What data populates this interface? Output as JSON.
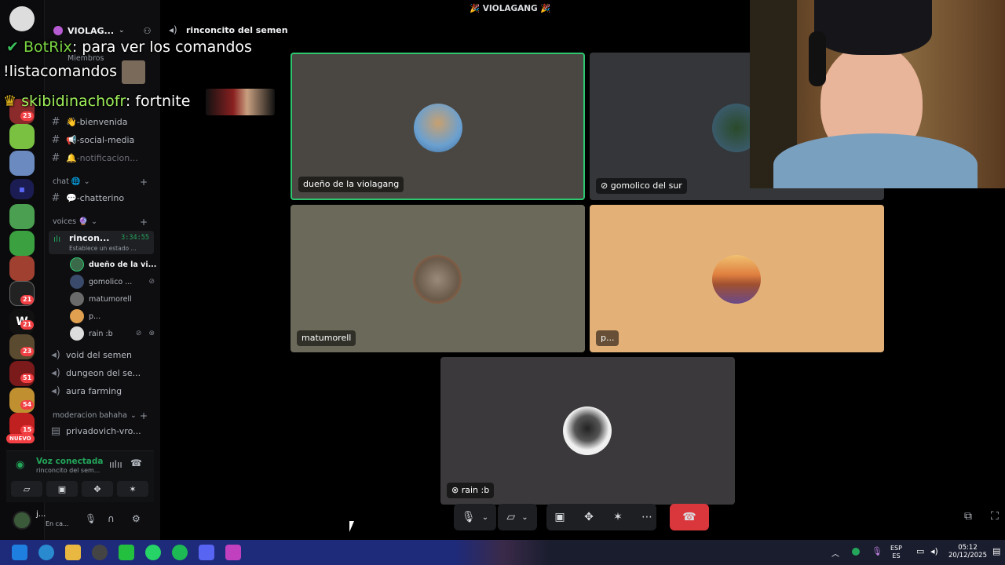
{
  "window": {
    "title": "🎉 VIOLAGANG 🎉"
  },
  "server": {
    "name": "VIOLAG...",
    "members_label": "Miembros"
  },
  "voice_channel_header": "rinconcito del semen",
  "chat_overlay": [
    {
      "user": "BotRix",
      "text": ": para ver los comandos"
    },
    {
      "user": "",
      "text": "!listacomandos"
    },
    {
      "user": "skibidinachofr",
      "text": ": fortnite"
    }
  ],
  "channels": {
    "text": [
      {
        "label": "👋-bienvenida"
      },
      {
        "label": "📢-social-media"
      },
      {
        "label": "🔔-notificacion..."
      }
    ],
    "chat_category": "chat 🌐",
    "chat": [
      {
        "label": "💬-chatterino"
      }
    ],
    "voices_category": "voices 🔮",
    "active_voice": {
      "name": "rincon...",
      "timer": "3:34:55",
      "status": "Establece un estado ..."
    },
    "voice_users": [
      {
        "name": "dueño de la vi...",
        "color": "#3a6a4a",
        "icon": ""
      },
      {
        "name": "gomolico ...",
        "color": "#3a4a6a",
        "icon": "mic-off"
      },
      {
        "name": "matumorell",
        "color": "#6a6a6a",
        "icon": ""
      },
      {
        "name": "p...",
        "color": "#e0a050",
        "icon": ""
      },
      {
        "name": "rain :b",
        "color": "#dddddd",
        "icon": "mic-off deafened"
      }
    ],
    "other_voice": [
      {
        "label": "void del semen"
      },
      {
        "label": "dungeon del se..."
      },
      {
        "label": "aura farming"
      }
    ],
    "mod_category": "moderacion bahaha",
    "mod": [
      {
        "label": "privadovich-vro..."
      }
    ]
  },
  "voice_panel": {
    "status": "Voz conectada",
    "channel": "rinconcito del sem..."
  },
  "user_panel": {
    "name": "j...",
    "status": "En ca..."
  },
  "tiles": [
    {
      "label": "dueño de la violagang",
      "bg": "#4a4742",
      "speaking": true,
      "avatar_color": "#6aa0d0"
    },
    {
      "label": "gomolico del sur",
      "bg": "#343639",
      "speaking": false,
      "avatar_color": "#3a5a3a"
    },
    {
      "label": "matumorell",
      "bg": "#6b6a5a",
      "speaking": false,
      "avatar_color": "#8a7a6a"
    },
    {
      "label": "p...",
      "bg": "#e3b078",
      "speaking": false,
      "avatar_color": "#e09040"
    },
    {
      "label": "rain :b",
      "bg": "#3b393b",
      "speaking": false,
      "avatar_color": "#e8e8e8"
    }
  ],
  "rail_badges": [
    "23",
    "21",
    "21",
    "23",
    "51",
    "54",
    "15"
  ],
  "rail_new": "NUEVO",
  "taskbar": {
    "lang_top": "ESP",
    "lang_bottom": "ES",
    "time": "05:12",
    "date": "20/12/2025"
  },
  "colors": {
    "accent_green": "#23a55a",
    "end_call_red": "#da373c",
    "speaking_outline": "#2dc770"
  }
}
